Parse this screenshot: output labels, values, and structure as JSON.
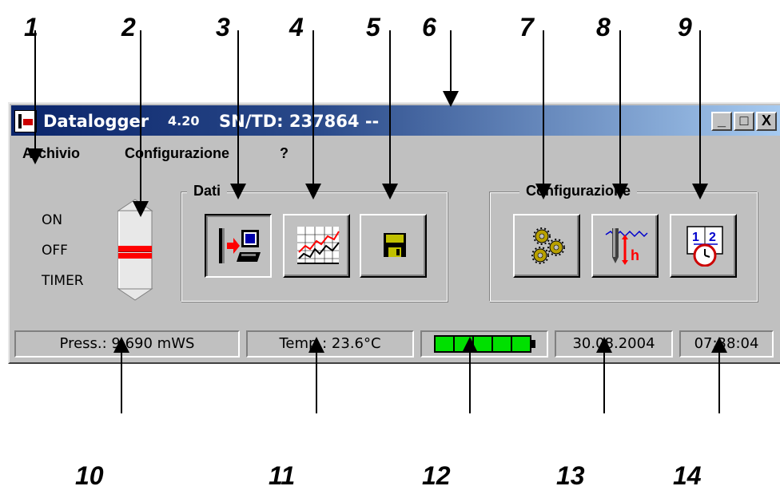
{
  "callouts": {
    "top": [
      "1",
      "2",
      "3",
      "4",
      "5",
      "6",
      "7",
      "8",
      "9"
    ],
    "bottom": [
      "10",
      "11",
      "12",
      "13",
      "14"
    ]
  },
  "window": {
    "title": "Datalogger",
    "version": "4.20",
    "serial": "SN/TD: 237864  --",
    "controls": {
      "minimize": "_",
      "maximize": "□",
      "close": "X"
    }
  },
  "menu": [
    "Archivio",
    "Configurazione",
    "?"
  ],
  "mode_switch": {
    "labels": [
      "ON",
      "OFF",
      "TIMER"
    ],
    "selected": "OFF"
  },
  "groups": {
    "dati": {
      "title": "Dati",
      "buttons": [
        {
          "icon": "download-to-pc-icon"
        },
        {
          "icon": "chart-graph-icon"
        },
        {
          "icon": "floppy-save-icon"
        }
      ]
    },
    "configurazione": {
      "title": "Configurazione",
      "buttons": [
        {
          "icon": "gears-settings-icon"
        },
        {
          "icon": "probe-level-icon"
        },
        {
          "icon": "calendar-clock-icon"
        }
      ]
    }
  },
  "status": {
    "pressure": "Press.: 9.690 mWS",
    "temperature": "Temp.: 23.6°C",
    "battery_level": 1.0,
    "battery_segments": 5,
    "date": "30.08.2004",
    "time": "07:38:04"
  },
  "colors": {
    "titlebar_start": "#0a246a",
    "titlebar_end": "#a6caf0",
    "window_bg": "#c0c0c0",
    "battery": "#00e000",
    "switch_indicator": "#ff0000"
  }
}
